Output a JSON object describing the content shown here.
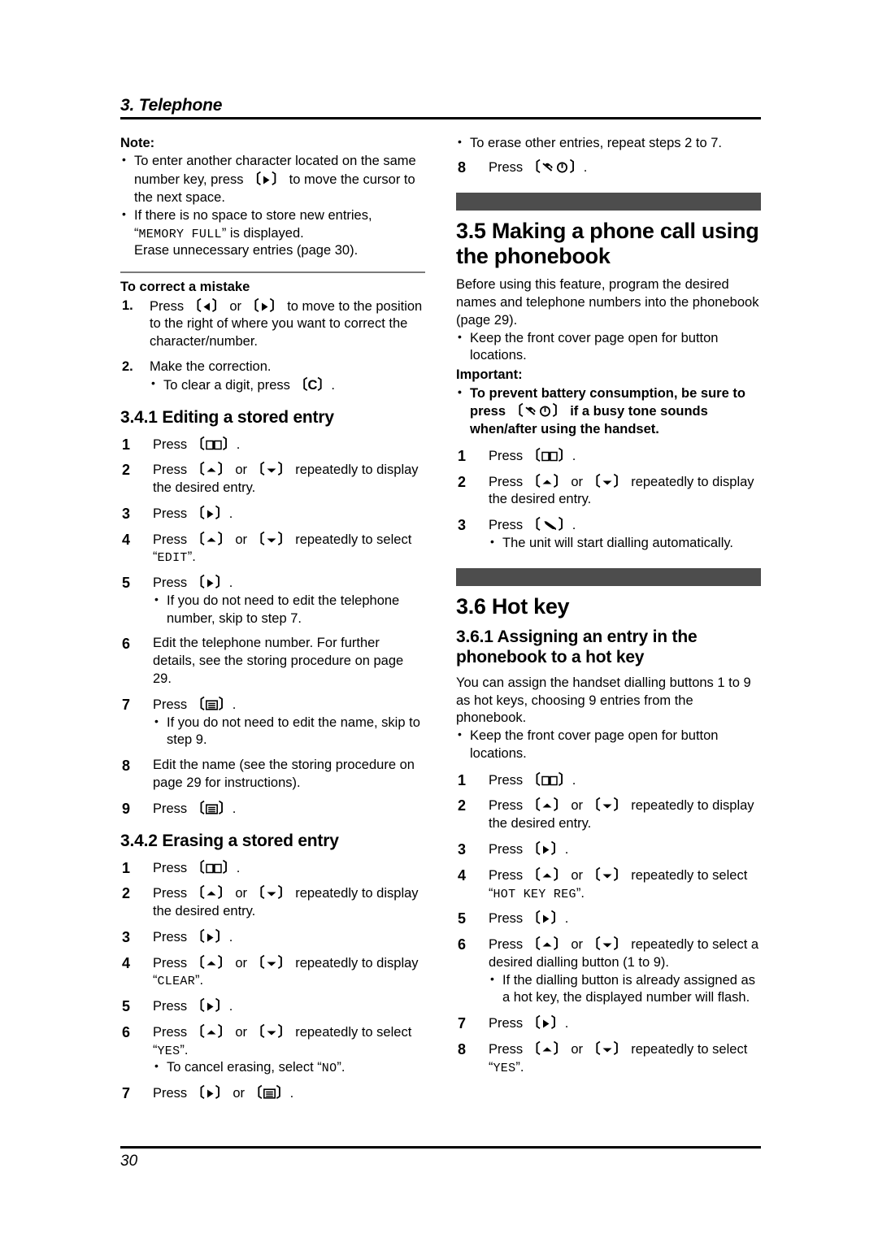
{
  "header": {
    "chapter": "3. Telephone"
  },
  "footer": {
    "page_number": "30"
  },
  "left_column": {
    "note": {
      "label": "Note:",
      "bullets": [
        {
          "pre": "To enter another character located on the same number key, press ",
          "key": "right-arrow",
          "post": " to move the cursor to the next space."
        },
        {
          "pre": "If there is no space to store new entries, “",
          "lcd": "MEMORY FULL",
          "post": "” is displayed.",
          "extra_line": "Erase unnecessary entries (page 30)."
        }
      ]
    },
    "correct_mistake": {
      "heading": "To correct a mistake",
      "steps": [
        {
          "num": "1.",
          "pre": "Press ",
          "key1": "left-arrow",
          "mid": " or ",
          "key2": "right-arrow",
          "post": " to move to the position to the right of where you want to correct the character/number."
        },
        {
          "num": "2.",
          "text": "Make the correction.",
          "sub": [
            {
              "pre": "To clear a digit, press ",
              "key": "C",
              "post": "."
            }
          ]
        }
      ]
    },
    "editing_entry": {
      "heading": "3.4.1 Editing a stored entry",
      "steps": [
        {
          "num": "1",
          "pre": "Press ",
          "key1": "phonebook",
          "post": "."
        },
        {
          "num": "2",
          "pre": "Press ",
          "key1": "up-arrow",
          "mid": " or ",
          "key2": "down-arrow",
          "post": " repeatedly to display the desired entry."
        },
        {
          "num": "3",
          "pre": "Press ",
          "key1": "right-arrow",
          "post": "."
        },
        {
          "num": "4",
          "pre": "Press ",
          "key1": "up-arrow",
          "mid": " or ",
          "key2": "down-arrow",
          "post": " repeatedly to select “",
          "lcd": "EDIT",
          "tail": "”."
        },
        {
          "num": "5",
          "pre": "Press ",
          "key1": "right-arrow",
          "post": ".",
          "sub": [
            {
              "text": "If you do not need to edit the telephone number, skip to step 7."
            }
          ]
        },
        {
          "num": "6",
          "text": "Edit the telephone number. For further details, see the storing procedure on page 29."
        },
        {
          "num": "7",
          "pre": "Press ",
          "key1": "menu",
          "post": ".",
          "sub": [
            {
              "text": "If you do not need to edit the name, skip to step 9."
            }
          ]
        },
        {
          "num": "8",
          "text": "Edit the name (see the storing procedure on page 29 for instructions)."
        },
        {
          "num": "9",
          "pre": "Press ",
          "key1": "menu",
          "post": "."
        }
      ]
    },
    "erasing_entry": {
      "heading": "3.4.2 Erasing a stored entry",
      "steps": [
        {
          "num": "1",
          "pre": "Press ",
          "key1": "phonebook",
          "post": "."
        },
        {
          "num": "2",
          "pre": "Press ",
          "key1": "up-arrow",
          "mid": " or ",
          "key2": "down-arrow",
          "post": " repeatedly to display the desired entry."
        },
        {
          "num": "3",
          "pre": "Press ",
          "key1": "right-arrow",
          "post": "."
        },
        {
          "num": "4",
          "pre": "Press ",
          "key1": "up-arrow",
          "mid": " or ",
          "key2": "down-arrow",
          "post": " repeatedly to display “",
          "lcd": "CLEAR",
          "tail": "”."
        },
        {
          "num": "5",
          "pre": "Press ",
          "key1": "right-arrow",
          "post": "."
        },
        {
          "num": "6",
          "pre": "Press ",
          "key1": "up-arrow",
          "mid": " or ",
          "key2": "down-arrow",
          "post": " repeatedly to select “",
          "lcd": "YES",
          "tail": "”.",
          "sub": [
            {
              "pre": "To cancel erasing, select “",
              "lcd": "NO",
              "post": "”."
            }
          ]
        },
        {
          "num": "7",
          "pre": "Press ",
          "key1": "right-arrow",
          "mid": " or ",
          "key2": "menu",
          "post": "."
        }
      ]
    }
  },
  "right_column": {
    "continued_step": {
      "bullet": "To erase other entries, repeat steps 2 to 7.",
      "step": {
        "num": "8",
        "pre": "Press ",
        "key1": "off-power",
        "post": "."
      }
    },
    "making_call": {
      "heading": "3.5 Making a phone call using the phonebook",
      "intro": "Before using this feature, program the desired names and telephone numbers into the phonebook (page 29).",
      "bullets": [
        "Keep the front cover page open for button locations."
      ],
      "important_label": "Important:",
      "important_bullet": {
        "pre": "To prevent battery consumption, be sure to press ",
        "key": "off-power",
        "post": " if a busy tone sounds when/after using the handset."
      },
      "steps": [
        {
          "num": "1",
          "pre": "Press ",
          "key1": "phonebook",
          "post": "."
        },
        {
          "num": "2",
          "pre": "Press ",
          "key1": "up-arrow",
          "mid": " or ",
          "key2": "down-arrow",
          "post": " repeatedly to display the desired entry."
        },
        {
          "num": "3",
          "pre": "Press ",
          "key1": "talk",
          "post": ".",
          "sub": [
            {
              "text": "The unit will start dialling automatically."
            }
          ]
        }
      ]
    },
    "hot_key": {
      "heading": "3.6 Hot key",
      "sub_heading": "3.6.1 Assigning an entry in the phonebook to a hot key",
      "intro": "You can assign the handset dialling buttons 1 to 9 as hot keys, choosing 9 entries from the phonebook.",
      "bullets": [
        "Keep the front cover page open for button locations."
      ],
      "steps": [
        {
          "num": "1",
          "pre": "Press ",
          "key1": "phonebook",
          "post": "."
        },
        {
          "num": "2",
          "pre": "Press ",
          "key1": "up-arrow",
          "mid": " or ",
          "key2": "down-arrow",
          "post": " repeatedly to display the desired entry."
        },
        {
          "num": "3",
          "pre": "Press ",
          "key1": "right-arrow",
          "post": "."
        },
        {
          "num": "4",
          "pre": "Press ",
          "key1": "up-arrow",
          "mid": " or ",
          "key2": "down-arrow",
          "post": " repeatedly to select “",
          "lcd": "HOT KEY REG",
          "tail": "”."
        },
        {
          "num": "5",
          "pre": "Press ",
          "key1": "right-arrow",
          "post": "."
        },
        {
          "num": "6",
          "pre": "Press ",
          "key1": "up-arrow",
          "mid": " or ",
          "key2": "down-arrow",
          "post": " repeatedly to select a desired dialling button (1 to 9).",
          "sub": [
            {
              "text": "If the dialling button is already assigned as a hot key, the displayed number will flash."
            }
          ]
        },
        {
          "num": "7",
          "pre": "Press ",
          "key1": "right-arrow",
          "post": "."
        },
        {
          "num": "8",
          "pre": "Press ",
          "key1": "up-arrow",
          "mid": " or ",
          "key2": "down-arrow",
          "post": " repeatedly to select “",
          "lcd": "YES",
          "tail": "”."
        }
      ]
    }
  },
  "colors": {
    "section_bar": "#4d4d4d",
    "rule": "#000000",
    "thin_rule": "#7a7a7a"
  }
}
